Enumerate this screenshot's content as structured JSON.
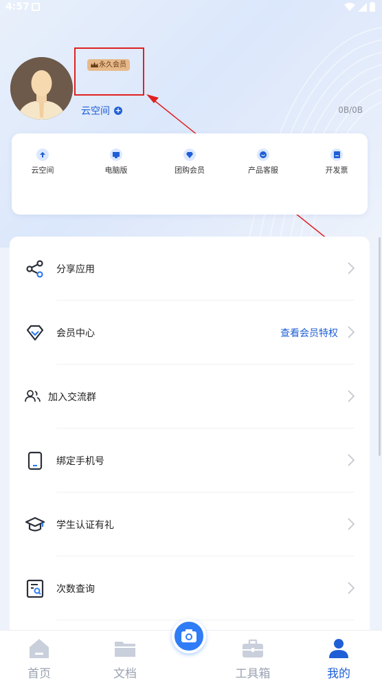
{
  "status_bar": {
    "time": "4:57"
  },
  "profile": {
    "vip_badge": "永久会员",
    "cloud_link": "云空间",
    "storage": "0B/0B"
  },
  "quick_actions": [
    {
      "label": "云空间",
      "icon": "cloud-upload-icon"
    },
    {
      "label": "电脑版",
      "icon": "monitor-icon"
    },
    {
      "label": "团购会员",
      "icon": "diamond-icon"
    },
    {
      "label": "产品客服",
      "icon": "chat-icon"
    },
    {
      "label": "开发票",
      "icon": "invoice-icon"
    }
  ],
  "menu": [
    {
      "label": "分享应用",
      "icon": "share-icon",
      "extra": ""
    },
    {
      "label": "会员中心",
      "icon": "diamond-icon",
      "extra": "查看会员特权"
    },
    {
      "label": "加入交流群",
      "icon": "group-icon",
      "extra": ""
    },
    {
      "label": "绑定手机号",
      "icon": "phone-icon",
      "extra": ""
    },
    {
      "label": "学生认证有礼",
      "icon": "graduation-cap-icon",
      "extra": ""
    },
    {
      "label": "次数查询",
      "icon": "search-document-icon",
      "extra": ""
    }
  ],
  "tabs": [
    {
      "label": "首页",
      "icon": "home-icon",
      "active": false
    },
    {
      "label": "文档",
      "icon": "folder-icon",
      "active": false
    },
    {
      "label": "工具箱",
      "icon": "toolbox-icon",
      "active": false
    },
    {
      "label": "我的",
      "icon": "user-icon",
      "active": true
    }
  ],
  "colors": {
    "accent": "#1f5fd6",
    "badge_bg": "#e7b989",
    "annotation_red": "#e02020"
  }
}
